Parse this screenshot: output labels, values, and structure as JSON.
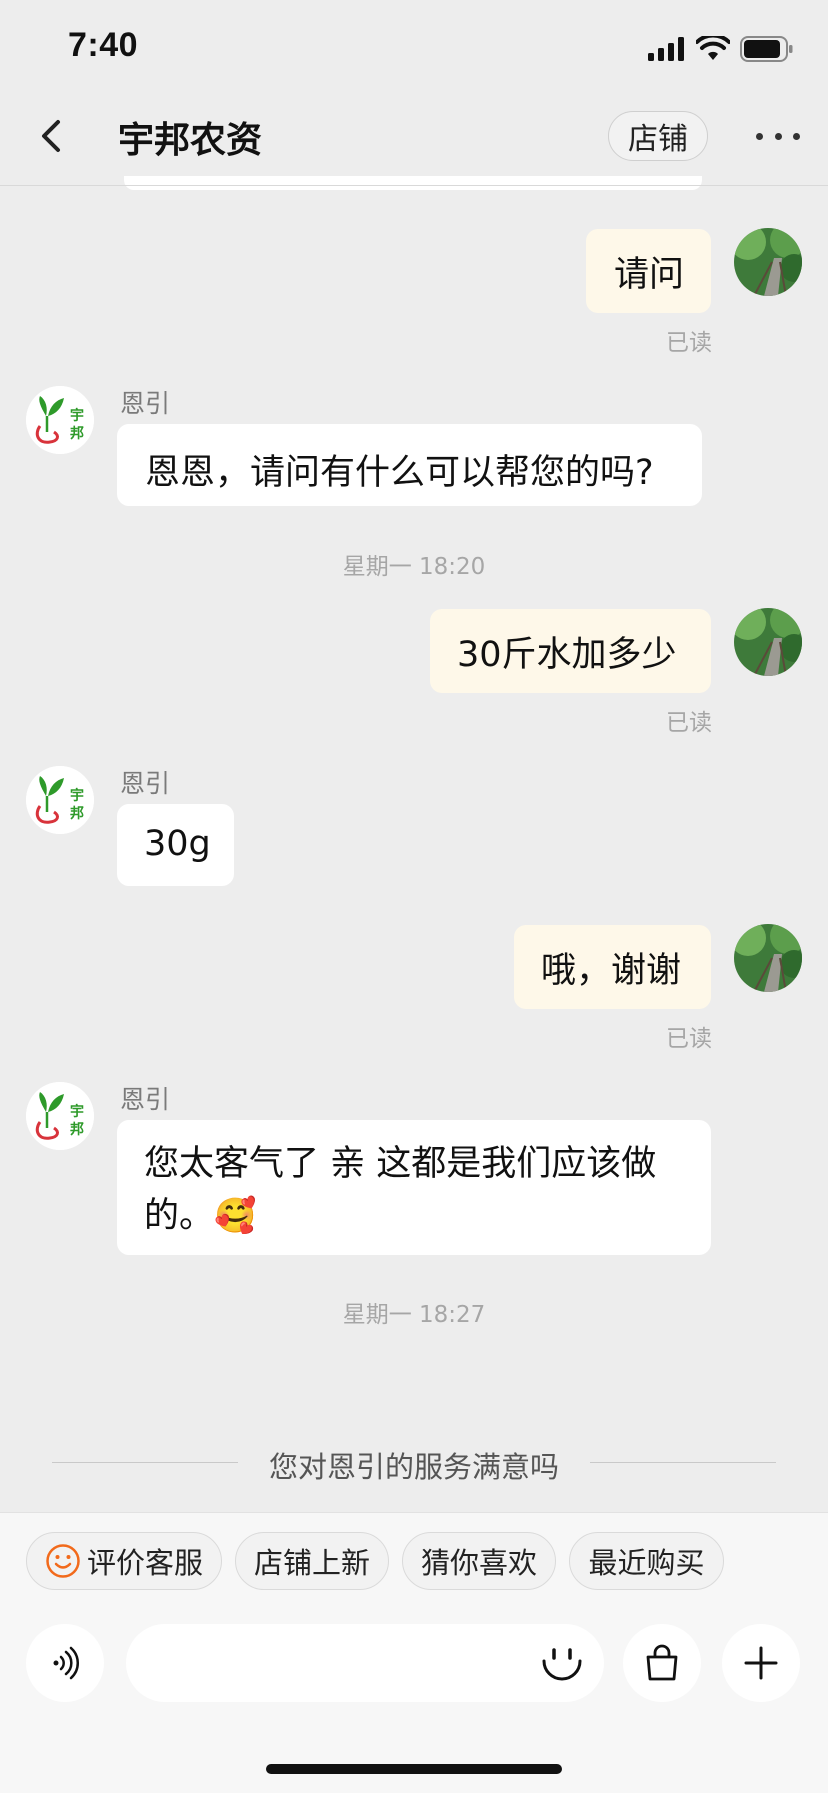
{
  "status_bar": {
    "time": "7:40"
  },
  "header": {
    "title": "宇邦农资",
    "shop_label": "店铺"
  },
  "messages": [
    {
      "side": "right",
      "text": "请问",
      "read": "已读"
    },
    {
      "side": "left",
      "sender": "恩引",
      "text": "恩恩，请问有什么可以帮您的吗?"
    },
    {
      "side": "center",
      "time": "星期一 18:20"
    },
    {
      "side": "right",
      "text": "30斤水加多少",
      "read": "已读"
    },
    {
      "side": "left",
      "sender": "恩引",
      "text": "30g"
    },
    {
      "side": "right",
      "text": "哦，谢谢",
      "read": "已读"
    },
    {
      "side": "left",
      "sender": "恩引",
      "line1": "您太客气了 亲  这都是我们应该做",
      "line2": "的。",
      "emoji": "🥰"
    },
    {
      "side": "center",
      "time": "星期一 18:27"
    }
  ],
  "shop_avatar": {
    "line1": "宇",
    "line2": "邦"
  },
  "satisfaction": {
    "text": "您对恩引的服务满意吗"
  },
  "quick_actions": [
    {
      "label": "评价客服",
      "icon": "smile-icon"
    },
    {
      "label": "店铺上新"
    },
    {
      "label": "猜你喜欢"
    },
    {
      "label": "最近购买"
    }
  ],
  "input": {
    "placeholder": ""
  },
  "colors": {
    "bubble_right": "#FEF8E9",
    "bubble_left": "#FFFFFF",
    "background": "#EDEDED",
    "accent": "#F26A1B",
    "logo_green": "#2E9A2A",
    "logo_red": "#D8333B"
  }
}
